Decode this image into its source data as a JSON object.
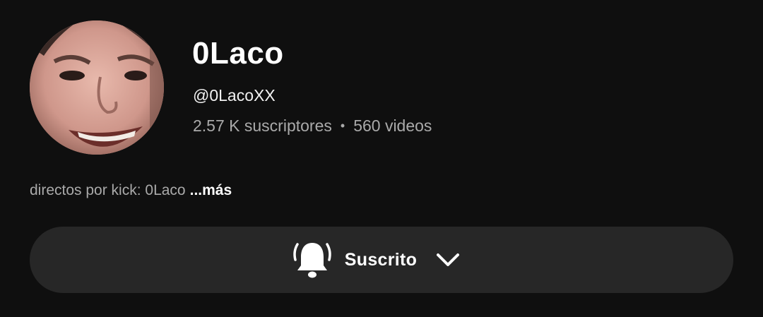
{
  "channel": {
    "name": "0Laco",
    "handle": "@0LacoXX",
    "subscribers": "2.57 K suscriptores",
    "separator": "•",
    "videos": "560 videos",
    "description": "directos por kick: 0Laco",
    "more_label": "...más"
  },
  "avatar": {
    "icon": "channel-avatar-photo"
  },
  "subscribe": {
    "label": "Suscrito",
    "bell_icon": "bell-ringing-icon",
    "chevron_icon": "chevron-down-icon"
  },
  "colors": {
    "background": "#0f0f0f",
    "button_background": "#272727",
    "secondary_text": "#aaaaaa",
    "primary_text": "#ffffff"
  }
}
